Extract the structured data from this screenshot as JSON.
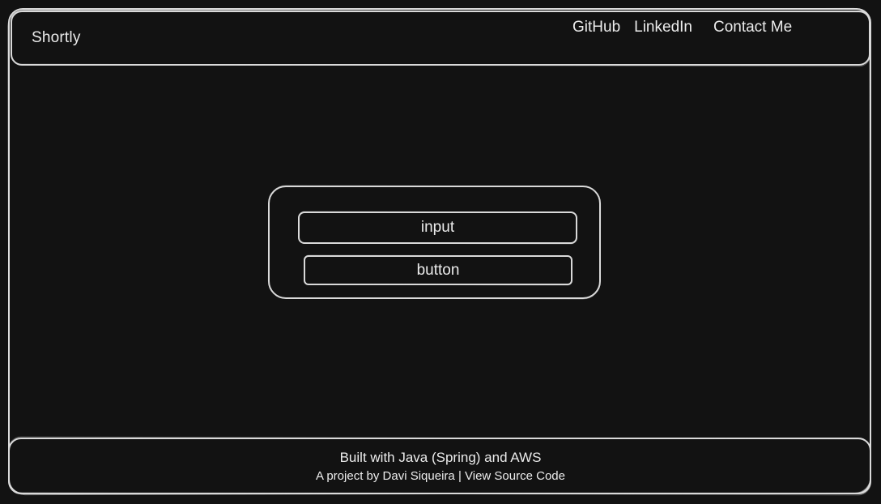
{
  "app": {
    "title": "Shortly"
  },
  "header": {
    "links": [
      {
        "label": "GitHub"
      },
      {
        "label": "LinkedIn"
      },
      {
        "label": "Contact Me"
      }
    ]
  },
  "form": {
    "input_label": "input",
    "button_label": "button"
  },
  "footer": {
    "line1": "Built with Java (Spring) and AWS",
    "line2_prefix": "A project by Davi Siqueira",
    "separator": "|",
    "source_link": "View Source Code"
  },
  "theme": {
    "background": "#121212",
    "stroke": "#d9d9d9",
    "text": "#ececec"
  }
}
